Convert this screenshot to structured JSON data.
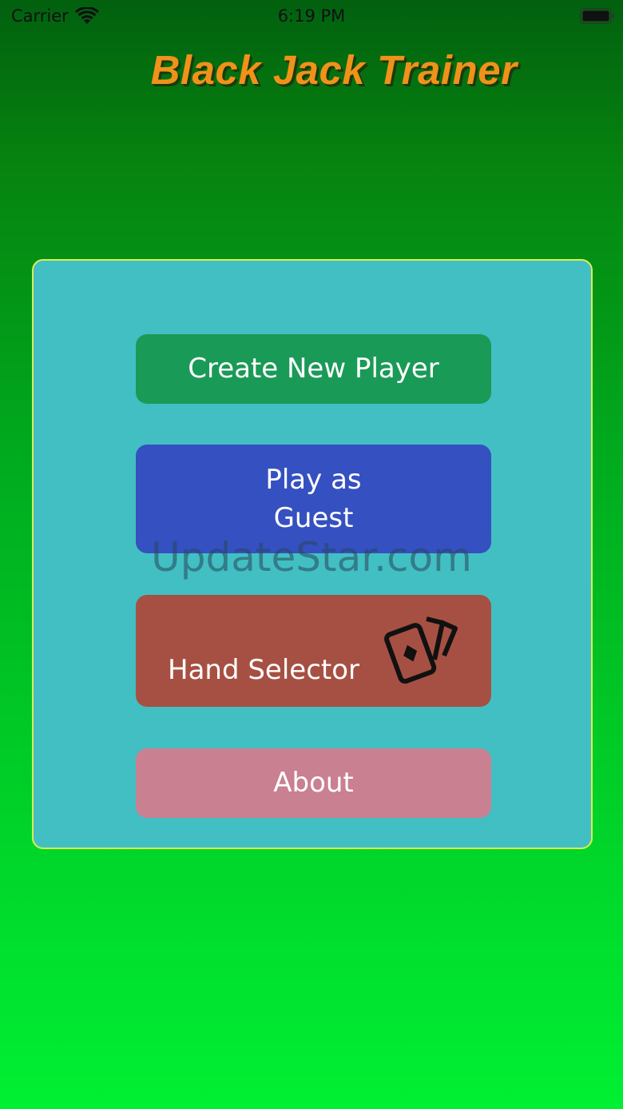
{
  "status_bar": {
    "carrier": "Carrier",
    "time": "6:19 PM",
    "wifi_icon": "wifi-icon",
    "battery_icon": "battery-icon"
  },
  "app": {
    "title": "Black Jack Trainer",
    "title_color": "#f0921a",
    "background_gradient": [
      "#02600f",
      "#00f033"
    ]
  },
  "menu": {
    "panel_color": "#42bfc3",
    "panel_border_color": "#d8f050",
    "buttons": [
      {
        "label": "Create New Player",
        "color": "#1a9a57"
      },
      {
        "label_line1": "Play as",
        "label_line2": "Guest",
        "color": "#3550c0"
      },
      {
        "label": "Hand Selector",
        "icon": "playing-cards-icon",
        "color": "#a65043"
      },
      {
        "label": "About",
        "color": "#c98091"
      }
    ]
  },
  "watermark": "UpdateStar.com"
}
